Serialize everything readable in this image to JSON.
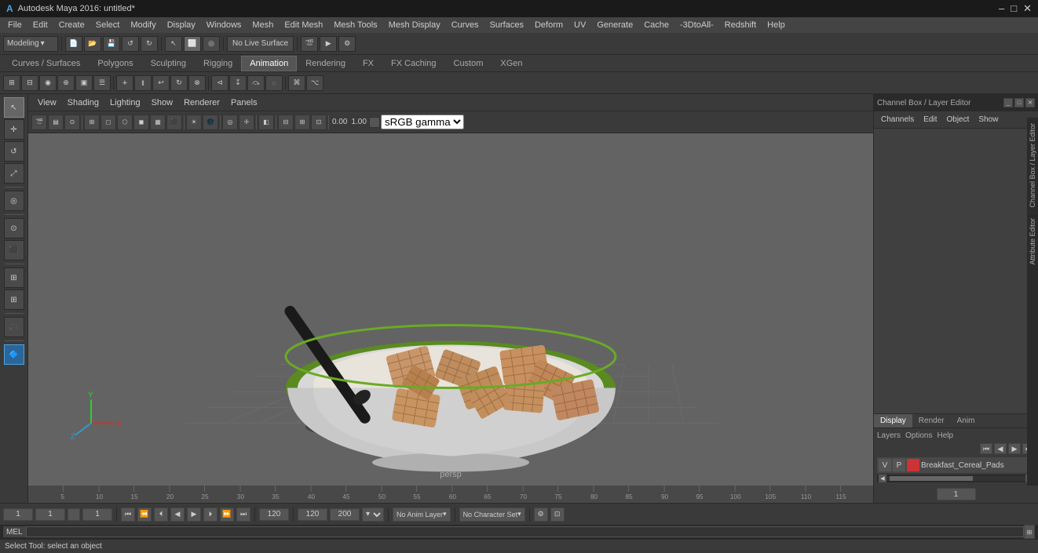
{
  "window": {
    "title": "Autodesk Maya 2016: untitled*",
    "logo": "A"
  },
  "titlebar": {
    "minimize": "–",
    "maximize": "□",
    "close": "✕"
  },
  "menubar": {
    "items": [
      "File",
      "Edit",
      "Create",
      "Select",
      "Modify",
      "Display",
      "Windows",
      "Mesh",
      "Edit Mesh",
      "Mesh Tools",
      "Mesh Display",
      "Curves",
      "Surfaces",
      "Deform",
      "UV",
      "Generate",
      "Cache",
      "-3DtoAll-",
      "Redshift",
      "Help"
    ]
  },
  "toolbar1": {
    "workspace_label": "Modeling",
    "live_surface": "No Live Surface"
  },
  "tabs": {
    "items": [
      "Curves / Surfaces",
      "Polygons",
      "Sculpting",
      "Rigging",
      "Animation",
      "Rendering",
      "FX",
      "FX Caching",
      "Custom",
      "XGen"
    ],
    "active": "Animation"
  },
  "viewport_menu": {
    "items": [
      "View",
      "Shading",
      "Lighting",
      "Show",
      "Renderer",
      "Panels"
    ]
  },
  "viewport": {
    "perspective_label": "persp",
    "bg_color": "#636363"
  },
  "viewport_toolbar": {
    "gamma_value": "sRGB gamma",
    "value1": "0.00",
    "value2": "1.00"
  },
  "right_panel": {
    "title": "Channel Box / Layer Editor",
    "channels_tabs": [
      "Channels",
      "Edit",
      "Object",
      "Show"
    ],
    "display_tabs": [
      "Display",
      "Render",
      "Anim"
    ],
    "active_display_tab": "Display",
    "layers_tabs": [
      "Layers",
      "Options",
      "Help"
    ],
    "layer_item": {
      "v": "V",
      "p": "P",
      "name": "Breakfast_Cereal_Pads"
    }
  },
  "timeline": {
    "ticks": [
      5,
      10,
      15,
      20,
      25,
      30,
      35,
      40,
      45,
      50,
      55,
      60,
      65,
      70,
      75,
      80,
      85,
      90,
      95,
      100,
      105,
      110,
      115
    ],
    "current_frame": "1",
    "right_frame": "1"
  },
  "bottom_controls": {
    "frame_start": "1",
    "frame_end": "120",
    "playback_start": "1",
    "playback_end": "120",
    "playback_end2": "200",
    "anim_layer": "No Anim Layer",
    "character": "No Character Set",
    "buttons": [
      "⏮",
      "⏪",
      "⏴",
      "◀",
      "▶",
      "⏵",
      "⏩",
      "⏭"
    ]
  },
  "script_bar": {
    "type": "MEL",
    "placeholder": ""
  },
  "status_bar": {
    "text": "Select Tool: select an object"
  },
  "icons": {
    "arrow_left": "◀",
    "arrow_right": "▶",
    "arrow_double_left": "«",
    "arrow_double_right": "»",
    "gear": "⚙",
    "plus": "+",
    "minus": "–",
    "check": "✓",
    "x": "✕",
    "chevron_down": "▾"
  }
}
